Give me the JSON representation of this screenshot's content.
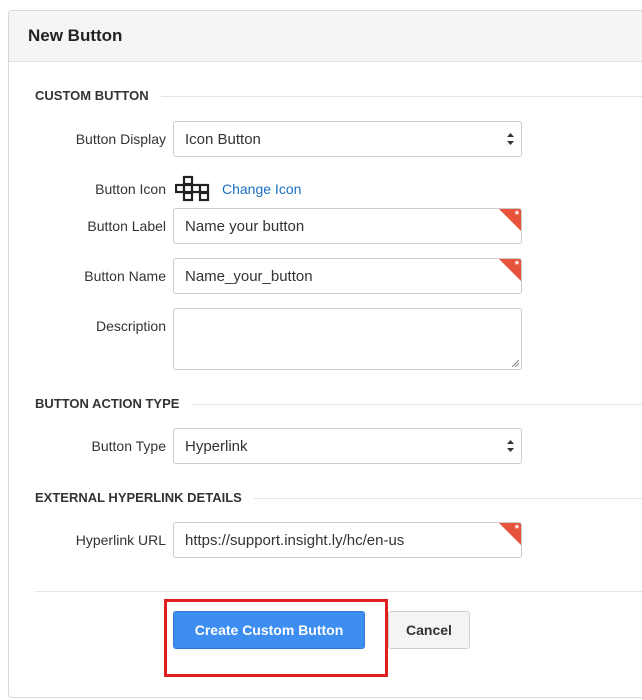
{
  "dialog": {
    "title": "New Button"
  },
  "sections": {
    "custom_button": "CUSTOM BUTTON",
    "action_type": "BUTTON ACTION TYPE",
    "hyperlink_details": "EXTERNAL HYPERLINK DETAILS"
  },
  "fields": {
    "button_display": {
      "label": "Button Display",
      "value": "Icon Button"
    },
    "button_icon": {
      "label": "Button Icon",
      "change_link": "Change Icon",
      "icon": "sitemap-blocks-icon"
    },
    "button_label": {
      "label": "Button Label",
      "value": "Name your button",
      "required_marker": "*"
    },
    "button_name": {
      "label": "Button Name",
      "value": "Name_your_button",
      "required_marker": "*"
    },
    "description": {
      "label": "Description",
      "value": ""
    },
    "button_type": {
      "label": "Button Type",
      "value": "Hyperlink"
    },
    "hyperlink_url": {
      "label": "Hyperlink URL",
      "value": "https://support.insight.ly/hc/en-us",
      "required_marker": "*"
    }
  },
  "actions": {
    "create_label": "Create Custom Button",
    "cancel_label": "Cancel"
  },
  "colors": {
    "primary": "#3d8ef0",
    "link": "#1a6fc4",
    "required": "#e8533b",
    "highlight": "#e0201f"
  }
}
